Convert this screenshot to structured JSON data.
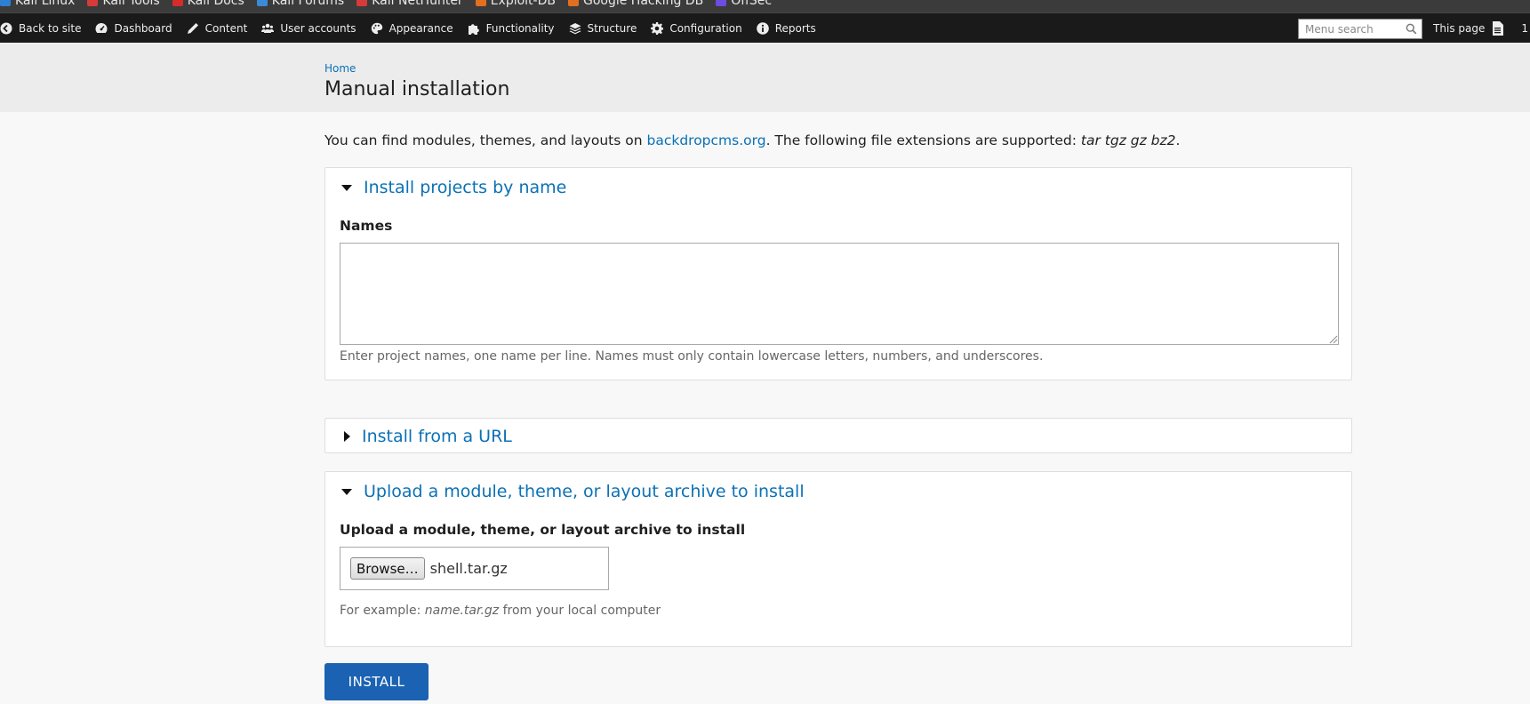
{
  "bookmarks": [
    {
      "label": "Kali Linux",
      "icon": "kali-icon",
      "color": "#2d7fd4"
    },
    {
      "label": "Kali Tools",
      "icon": "kali-tools-icon",
      "color": "#d63a3a"
    },
    {
      "label": "Kali Docs",
      "icon": "kali-docs-icon",
      "color": "#d62b2b"
    },
    {
      "label": "Kali Forums",
      "icon": "kali-forums-icon",
      "color": "#3a8ad6"
    },
    {
      "label": "Kali NetHunter",
      "icon": "nethunter-icon",
      "color": "#d63a3a"
    },
    {
      "label": "Exploit-DB",
      "icon": "exploit-db-icon",
      "color": "#e07020"
    },
    {
      "label": "Google Hacking DB",
      "icon": "ghdb-icon",
      "color": "#e07020"
    },
    {
      "label": "OffSec",
      "icon": "offsec-icon",
      "color": "#6b4de0"
    }
  ],
  "admin_bar": {
    "items": [
      {
        "label": "Back to site",
        "icon": "back-arrow-icon"
      },
      {
        "label": "Dashboard",
        "icon": "dashboard-icon"
      },
      {
        "label": "Content",
        "icon": "pencil-icon"
      },
      {
        "label": "User accounts",
        "icon": "users-icon"
      },
      {
        "label": "Appearance",
        "icon": "palette-icon"
      },
      {
        "label": "Functionality",
        "icon": "puzzle-icon"
      },
      {
        "label": "Structure",
        "icon": "layers-icon"
      },
      {
        "label": "Configuration",
        "icon": "gear-icon"
      },
      {
        "label": "Reports",
        "icon": "info-icon"
      }
    ],
    "search_placeholder": "Menu search",
    "this_page_label": "This page",
    "page_counter": "1"
  },
  "header": {
    "breadcrumb": "Home",
    "title": "Manual installation"
  },
  "intro": {
    "text_before": "You can find modules, themes, and layouts on ",
    "link": "backdropcms.org",
    "text_after": ". The following file extensions are supported: ",
    "extensions": "tar tgz gz bz2",
    "end": "."
  },
  "install_by_name": {
    "legend": "Install projects by name",
    "field_label": "Names",
    "textarea_value": "",
    "description": "Enter project names, one name per line. Names must only contain lowercase letters, numbers, and underscores."
  },
  "install_from_url": {
    "legend": "Install from a URL"
  },
  "upload_archive": {
    "legend": "Upload a module, theme, or layout archive to install",
    "field_label": "Upload a module, theme, or layout archive to install",
    "browse_label": "Browse…",
    "file_name": "shell.tar.gz",
    "desc_prefix": "For example: ",
    "desc_example": "name.tar.gz",
    "desc_suffix": " from your local computer"
  },
  "install_button": "INSTALL",
  "colors": {
    "link": "#0b71b5",
    "button": "#1b62b3",
    "toolbar": "#1a1a1a"
  }
}
